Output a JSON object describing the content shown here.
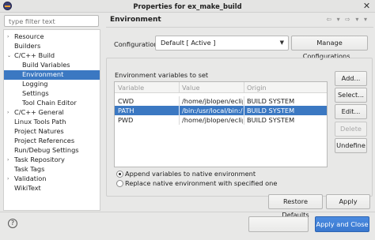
{
  "window": {
    "title": "Properties for ex_make_build",
    "close_glyph": "✕"
  },
  "filter": {
    "placeholder": "type filter text"
  },
  "tree": [
    {
      "label": "Resource",
      "expander": "›"
    },
    {
      "label": "Builders",
      "expander": ""
    },
    {
      "label": "C/C++ Build",
      "expander": "⌄"
    },
    {
      "label": "Build Variables",
      "expander": ""
    },
    {
      "label": "Environment",
      "expander": ""
    },
    {
      "label": "Logging",
      "expander": ""
    },
    {
      "label": "Settings",
      "expander": ""
    },
    {
      "label": "Tool Chain Editor",
      "expander": ""
    },
    {
      "label": "C/C++ General",
      "expander": "›"
    },
    {
      "label": "Linux Tools Path",
      "expander": ""
    },
    {
      "label": "Project Natures",
      "expander": ""
    },
    {
      "label": "Project References",
      "expander": ""
    },
    {
      "label": "Run/Debug Settings",
      "expander": ""
    },
    {
      "label": "Task Repository",
      "expander": "›"
    },
    {
      "label": "Task Tags",
      "expander": ""
    },
    {
      "label": "Validation",
      "expander": "›"
    },
    {
      "label": "WikiText",
      "expander": ""
    }
  ],
  "page": {
    "title": "Environment",
    "nav": "⇦ ▾ ⇨ ▾ ▾",
    "configuration_label": "Configuration:",
    "configuration_value": "Default  [ Active ]",
    "manage_button": "Manage Configurations...",
    "env_label": "Environment variables to set",
    "columns": [
      "Variable",
      "Value",
      "Origin"
    ],
    "rows": [
      {
        "variable": "CWD",
        "value": "/home/jblopen/eclipse",
        "origin": "BUILD SYSTEM"
      },
      {
        "variable": "PATH",
        "value": "/bin:/usr/local/bin:/usr/",
        "origin": "BUILD SYSTEM"
      },
      {
        "variable": "PWD",
        "value": "/home/jblopen/eclipse",
        "origin": "BUILD SYSTEM"
      }
    ],
    "side_buttons": {
      "add": "Add...",
      "select": "Select...",
      "edit": "Edit...",
      "delete": "Delete",
      "undefine": "Undefine"
    },
    "radio_append": "Append variables to native environment",
    "radio_replace": "Replace native environment with specified one",
    "restore_defaults": "Restore Defaults",
    "apply": "Apply"
  },
  "footer": {
    "help_glyph": "?",
    "apply_close": "Apply and Close"
  }
}
